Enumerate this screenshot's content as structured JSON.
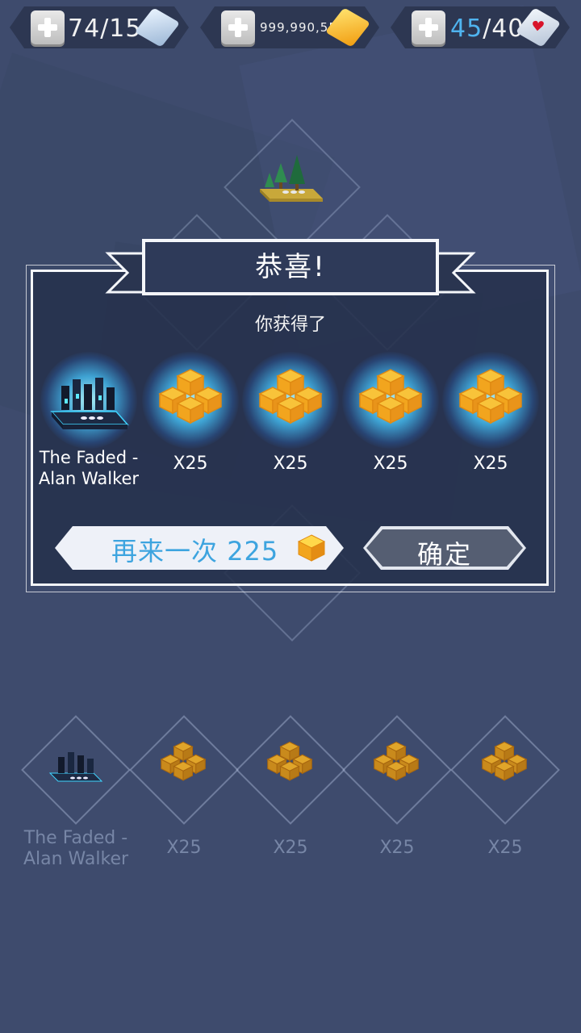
{
  "currencies": [
    {
      "name": "cubes",
      "current": "74",
      "max": "15",
      "icon": "ice-cube-icon"
    },
    {
      "name": "gold",
      "amount": "999,990,556",
      "icon": "gold-cube-icon"
    },
    {
      "name": "lives",
      "current": "45",
      "max": "40",
      "icon": "heart-cube-icon"
    }
  ],
  "dialog": {
    "title": "恭喜!",
    "subtitle": "你获得了",
    "rewards": [
      {
        "type": "song",
        "label": "The Faded - Alan Walker",
        "icon": "song-level-icon"
      },
      {
        "type": "gold",
        "label": "X25",
        "icon": "gold-pile-icon"
      },
      {
        "type": "gold",
        "label": "X25",
        "icon": "gold-pile-icon"
      },
      {
        "type": "gold",
        "label": "X25",
        "icon": "gold-pile-icon"
      },
      {
        "type": "gold",
        "label": "X25",
        "icon": "gold-pile-icon"
      }
    ],
    "again_button": {
      "label": "再来一次",
      "cost": "225"
    },
    "confirm_button": {
      "label": "确定"
    }
  },
  "history": [
    {
      "type": "song",
      "label": "The Faded - Alan Walker"
    },
    {
      "type": "gold",
      "label": "X25"
    },
    {
      "type": "gold",
      "label": "X25"
    },
    {
      "type": "gold",
      "label": "X25"
    },
    {
      "type": "gold",
      "label": "X25"
    }
  ],
  "colors": {
    "background": "#3e4b6d",
    "accent": "#3da4df",
    "gold": "#f6b81c"
  }
}
